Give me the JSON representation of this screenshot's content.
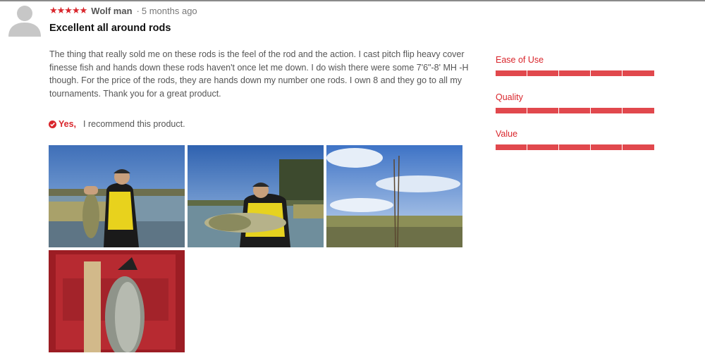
{
  "review": {
    "rating_stars": "★★★★★",
    "rating_value": 5,
    "reviewer": "Wolf man",
    "separator": "·",
    "age": "5 months ago",
    "title": "Excellent all around rods",
    "body": "The thing that really sold me on these rods is the feel of the rod and the action. I cast pitch flip heavy cover finesse fish and hands down these rods haven't once let me down. I do wish there were some 7'6\"-8' MH -H though. For the price of the rods, they are hands down my number one rods. I own 8 and they go to all my tournaments. Thank you for a great product.",
    "recommend_yes": "Yes,",
    "recommend_text": "I recommend this product."
  },
  "ratings": [
    {
      "label": "Ease of Use",
      "value": 5,
      "max": 5
    },
    {
      "label": "Quality",
      "value": 5,
      "max": 5
    },
    {
      "label": "Value",
      "value": 5,
      "max": 5
    }
  ],
  "photos": [
    {
      "name": "angler holding bass at lake"
    },
    {
      "name": "angler holding largemouth bass"
    },
    {
      "name": "fishing rods in marsh grass"
    },
    {
      "name": "bass on measuring board"
    }
  ],
  "colors": {
    "accent": "#d9262c",
    "bar_fill": "#e1484d",
    "text": "#555555"
  }
}
